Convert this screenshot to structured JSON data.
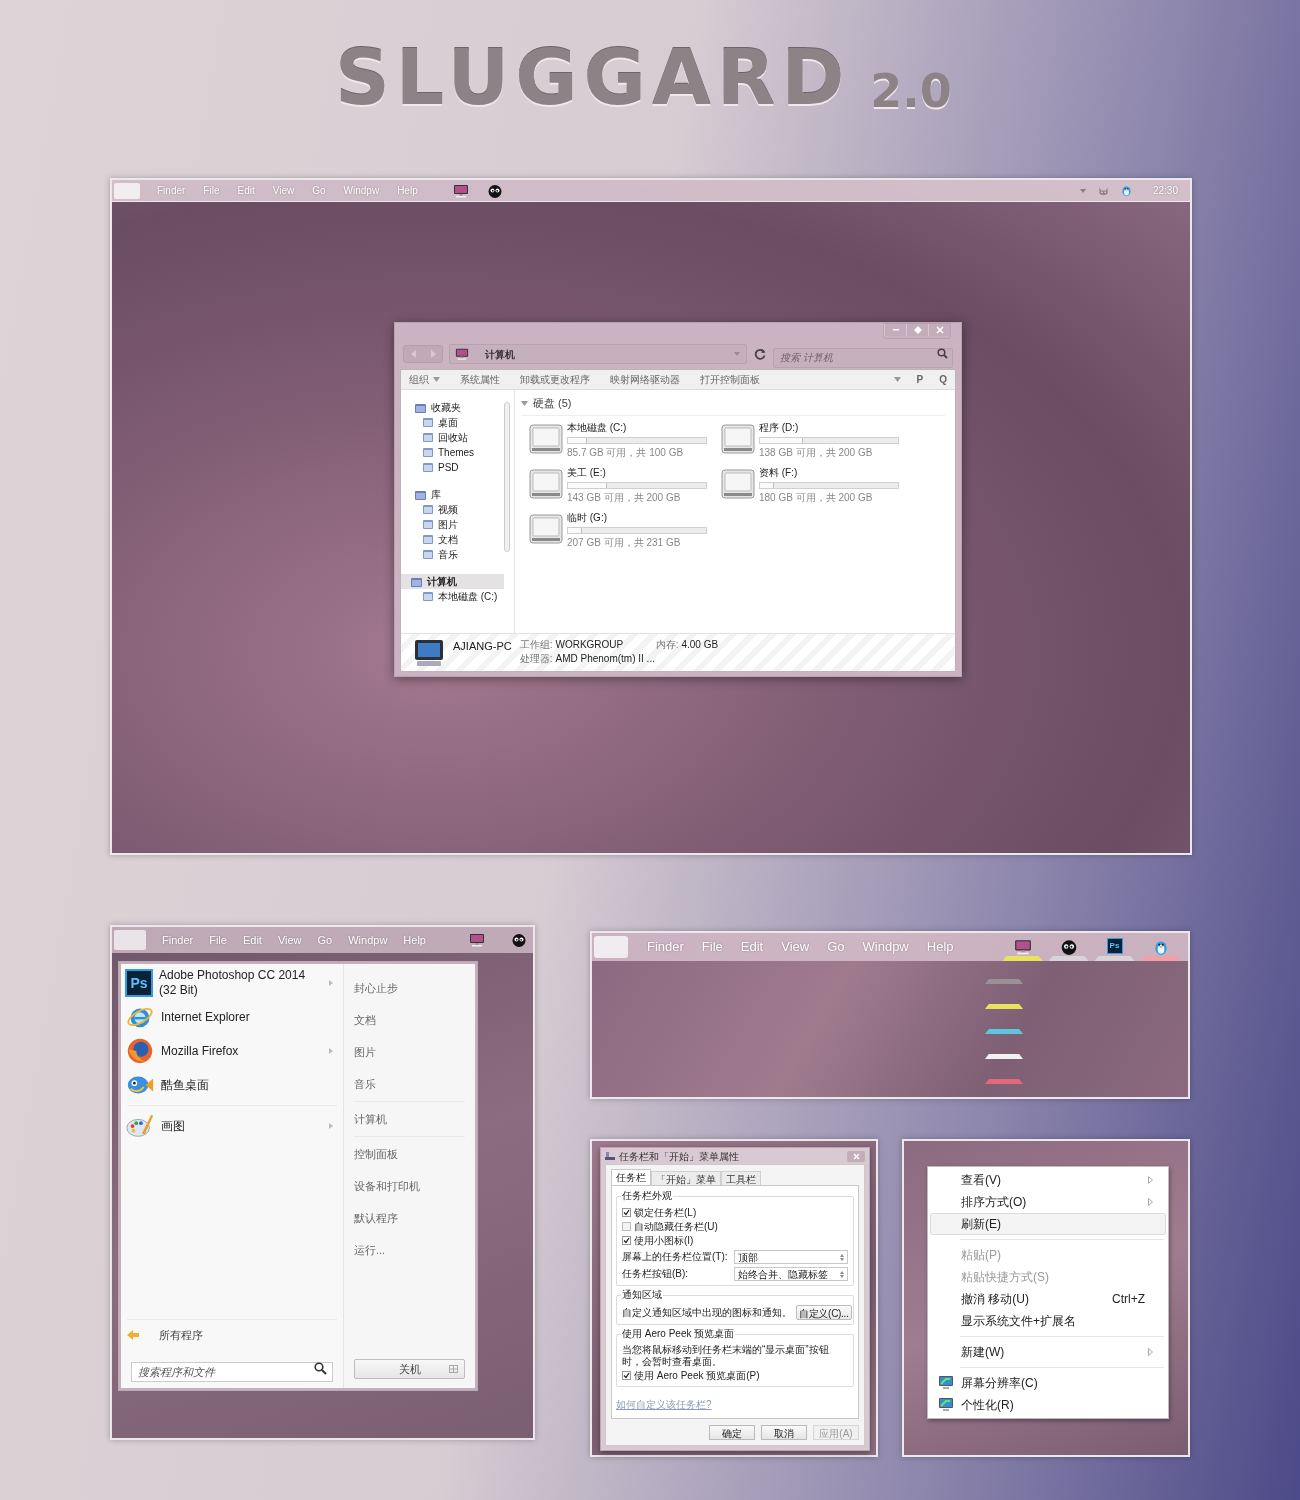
{
  "title": {
    "text": "SLUGGARD",
    "version": "2.0"
  },
  "main_screen": {
    "menu_bar": {
      "items": [
        "Finder",
        "File",
        "Edit",
        "View",
        "Go",
        "Windpw",
        "Help"
      ],
      "app_icons": [
        {
          "kind": "monitor"
        },
        {
          "kind": "mascot"
        }
      ],
      "status_icons": [
        {
          "kind": "caret"
        },
        {
          "kind": "cat"
        },
        {
          "kind": "penguin"
        }
      ],
      "clock": "22:30"
    },
    "explorer": {
      "address": "计算机",
      "search_placeholder": "搜索 计算机",
      "toolbar": [
        {
          "label": "组织",
          "dropdown": true
        },
        {
          "label": "系统属性",
          "dropdown": false
        },
        {
          "label": "卸载或更改程序",
          "dropdown": false
        },
        {
          "label": "映射网络驱动器",
          "dropdown": false
        },
        {
          "label": "打开控制面板",
          "dropdown": false
        }
      ],
      "toolbar_buttons": [
        "P",
        "Q"
      ],
      "sidebar": [
        {
          "label": "收藏夹",
          "selected": false,
          "children": [
            {
              "label": "桌面"
            },
            {
              "label": "回收站"
            },
            {
              "label": "Themes"
            },
            {
              "label": "PSD"
            }
          ]
        },
        {
          "label": "库",
          "selected": false,
          "children": [
            {
              "label": "视频"
            },
            {
              "label": "图片"
            },
            {
              "label": "文档"
            },
            {
              "label": "音乐"
            }
          ]
        },
        {
          "label": "计算机",
          "selected": true,
          "children": [
            {
              "label": "本地磁盘 (C:)"
            }
          ]
        }
      ],
      "group": {
        "label": "硬盘 (5)",
        "expanded": true
      },
      "drives": [
        {
          "name": "本地磁盘 (C:)",
          "level": 0.14,
          "info": "85.7 GB 可用，共 100 GB"
        },
        {
          "name": "程序 (D:)",
          "level": 0.31,
          "info": "138 GB 可用，共 200 GB"
        },
        {
          "name": "美工 (E:)",
          "level": 0.28,
          "info": "143 GB 可用，共 200 GB"
        },
        {
          "name": "资料 (F:)",
          "level": 0.1,
          "info": "180 GB 可用，共 200 GB"
        },
        {
          "name": "临时 (G:)",
          "level": 0.1,
          "info": "207 GB 可用，共 231 GB"
        }
      ],
      "details": {
        "computer": "AJIANG-PC",
        "fields": [
          {
            "label": "工作组:",
            "value": "WORKGROUP"
          },
          {
            "label": "内存:",
            "value": "4.00 GB"
          },
          {
            "label": "处理器:",
            "value": "AMD Phenom(tm) II ..."
          }
        ]
      }
    }
  },
  "start_screen": {
    "menu_bar": {
      "items": [
        "Finder",
        "File",
        "Edit",
        "View",
        "Go",
        "Windpw",
        "Help"
      ],
      "app_icons": [
        {
          "kind": "monitor"
        },
        {
          "kind": "mascot"
        }
      ]
    },
    "start_menu": {
      "program_groups": [
        [
          {
            "label": "Adobe Photoshop CC 2014 (32 Bit)",
            "kind": "ps",
            "icon_text": "Ps",
            "submenu": true
          },
          {
            "label": "Internet Explorer",
            "kind": "ie",
            "submenu": false
          },
          {
            "label": "Mozilla Firefox",
            "kind": "firefox",
            "submenu": true
          },
          {
            "label": "酷鱼桌面",
            "kind": "fish",
            "submenu": false
          }
        ],
        [
          {
            "label": "画图",
            "kind": "paint",
            "submenu": true
          }
        ]
      ],
      "all_programs": "所有程序",
      "search_placeholder": "搜索程序和文件",
      "place_groups": [
        [
          "封心止步",
          "文档",
          "图片",
          "音乐"
        ],
        [
          "计算机"
        ],
        [
          "控制面板",
          "设备和打印机",
          "默认程序",
          "运行..."
        ]
      ],
      "shutdown": "关机"
    }
  },
  "dock_screen": {
    "menu_bar": {
      "items": [
        "Finder",
        "File",
        "Edit",
        "View",
        "Go",
        "Windpw",
        "Help"
      ]
    },
    "dock_icons": [
      {
        "kind": "monitor",
        "color": "#e8e35c"
      },
      {
        "kind": "mascot",
        "color": "#d9d3d8"
      },
      {
        "kind": "ps",
        "icon_text": "Ps",
        "color": "#d9d3d8"
      },
      {
        "kind": "penguin",
        "color": "#f0a0a6"
      }
    ],
    "shelves": [
      {
        "color": "#9a9096"
      },
      {
        "color": "#e8e35c"
      },
      {
        "color": "#5cc6de"
      },
      {
        "color": "#f2f2f2"
      },
      {
        "color": "#e06a7a"
      }
    ]
  },
  "properties_dialog": {
    "title": "任务栏和「开始」菜单属性",
    "tabs": [
      {
        "label": "任务栏",
        "selected": true
      },
      {
        "label": "「开始」菜单",
        "selected": false
      },
      {
        "label": "工具栏",
        "selected": false
      }
    ],
    "appearance": {
      "legend": "任务栏外观",
      "checkboxes": [
        {
          "label": "锁定任务栏(L)",
          "checked": true
        },
        {
          "label": "自动隐藏任务栏(U)",
          "checked": false
        },
        {
          "label": "使用小图标(I)",
          "checked": true
        }
      ],
      "selects": [
        {
          "label": "屏幕上的任务栏位置(T):",
          "value": "顶部"
        },
        {
          "label": "任务栏按钮(B):",
          "value": "始终合并、隐藏标签"
        }
      ]
    },
    "notification": {
      "legend": "通知区域",
      "text": "自定义通知区域中出现的图标和通知。",
      "button": "自定义(C)..."
    },
    "aero_peek": {
      "legend": "使用 Aero Peek 预览桌面",
      "text": "当您将鼠标移动到任务栏末端的“显示桌面”按钮时，会暂时查看桌面。",
      "checkbox": {
        "label": "使用 Aero Peek 预览桌面(P)",
        "checked": true
      }
    },
    "link": "如何自定义该任务栏?",
    "buttons": [
      {
        "label": "确定",
        "disabled": false
      },
      {
        "label": "取消",
        "disabled": false
      },
      {
        "label": "应用(A)",
        "disabled": true
      }
    ]
  },
  "context_menu": {
    "groups": [
      [
        {
          "label": "查看(V)",
          "submenu": true,
          "disabled": false,
          "highlighted": false,
          "icon": false
        },
        {
          "label": "排序方式(O)",
          "submenu": true,
          "disabled": false,
          "highlighted": false,
          "icon": false
        },
        {
          "label": "刷新(E)",
          "submenu": false,
          "disabled": false,
          "highlighted": true,
          "icon": false
        }
      ],
      [
        {
          "label": "粘贴(P)",
          "submenu": false,
          "disabled": true,
          "highlighted": false,
          "icon": false
        },
        {
          "label": "粘贴快捷方式(S)",
          "submenu": false,
          "disabled": true,
          "highlighted": false,
          "icon": false
        },
        {
          "label": "撤消 移动(U)",
          "shortcut": "Ctrl+Z",
          "submenu": false,
          "disabled": false,
          "highlighted": false,
          "icon": false
        },
        {
          "label": "显示系统文件+扩展名",
          "submenu": false,
          "disabled": false,
          "highlighted": false,
          "icon": false
        }
      ],
      [
        {
          "label": "新建(W)",
          "submenu": true,
          "disabled": false,
          "highlighted": false,
          "icon": false
        }
      ],
      [
        {
          "label": "屏幕分辨率(C)",
          "submenu": false,
          "disabled": false,
          "highlighted": false,
          "icon": true
        },
        {
          "label": "个性化(R)",
          "submenu": false,
          "disabled": false,
          "highlighted": false,
          "icon": true
        }
      ]
    ]
  }
}
